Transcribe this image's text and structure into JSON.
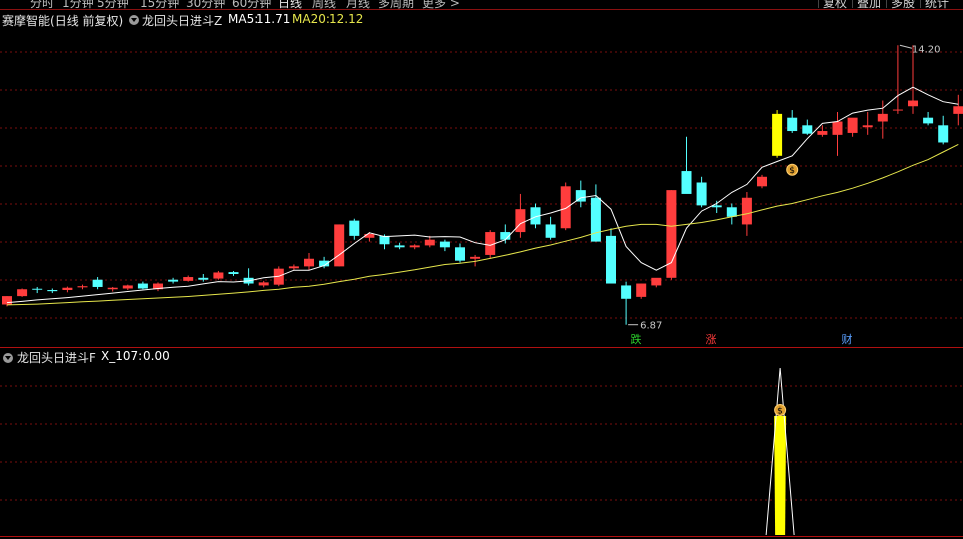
{
  "toolbar": {
    "periods": [
      "分时",
      "1分钟",
      "5分钟",
      "15分钟",
      "30分钟",
      "60分钟",
      "日线",
      "周线",
      "月线",
      "多周期",
      "更多 >"
    ],
    "active_period": "日线",
    "buttons": [
      "复权",
      "叠加",
      "多股",
      "统计"
    ]
  },
  "main_panel": {
    "stock_name": "赛摩智能",
    "view_mode": "(日线 前复权)",
    "indicator_name": "龙回头日进斗Z",
    "ma5_label": "MA5:",
    "ma5_value": "11.71",
    "ma20_label": "MA20:",
    "ma20_value": "12.12",
    "max_label": "14.20",
    "min_label": "6.87",
    "event_tags": [
      {
        "text": "跌",
        "color": "#2bd02b"
      },
      {
        "text": "涨",
        "color": "#ff3c3c"
      },
      {
        "text": "财",
        "color": "#5aa0ff"
      }
    ]
  },
  "sub_panel": {
    "indicator_name": "龙回头日进斗F",
    "var_label": "X_107:",
    "var_value": "0.00"
  },
  "colors": {
    "up": "#ff3d3d",
    "down": "#54ffff",
    "ma5": "#ffffff",
    "ma20": "#e6e64c",
    "grid": "#7a0e0e",
    "signal": "#ffff00",
    "special": "#ffff00"
  },
  "chart_data": [
    {
      "type": "candlestick",
      "title": "赛摩智能 (日线 前复权)",
      "ylim": [
        6.6,
        14.6
      ],
      "series": [
        {
          "name": "MA5",
          "values": [
            7.45,
            7.48,
            7.52,
            7.55,
            7.58,
            7.62,
            7.66,
            7.7,
            7.74,
            7.78,
            7.82,
            7.85,
            7.88,
            7.94,
            8.0,
            7.99,
            8.02,
            8.1,
            8.14,
            8.3,
            8.3,
            8.42,
            8.7,
            9.0,
            9.28,
            9.18,
            9.2,
            9.22,
            9.17,
            9.18,
            9.17,
            9.02,
            8.95,
            9.1,
            9.52,
            9.7,
            9.8,
            9.92,
            10.2,
            10.26,
            9.9,
            8.92,
            8.5,
            8.3,
            8.5,
            9.4,
            9.85,
            10.05,
            10.34,
            10.55,
            11.0,
            11.15,
            11.3,
            11.75,
            12.15,
            12.2,
            12.42,
            12.5,
            12.55,
            12.88,
            13.1,
            12.9,
            12.72,
            12.65
          ]
        },
        {
          "name": "MA20",
          "values": [
            7.39,
            7.4,
            7.41,
            7.43,
            7.45,
            7.47,
            7.49,
            7.51,
            7.53,
            7.55,
            7.57,
            7.59,
            7.61,
            7.64,
            7.67,
            7.7,
            7.73,
            7.77,
            7.8,
            7.85,
            7.88,
            7.93,
            8.0,
            8.06,
            8.14,
            8.19,
            8.25,
            8.31,
            8.38,
            8.45,
            8.48,
            8.53,
            8.61,
            8.69,
            8.78,
            8.88,
            8.96,
            9.06,
            9.16,
            9.28,
            9.37,
            9.45,
            9.5,
            9.5,
            9.45,
            9.5,
            9.55,
            9.62,
            9.7,
            9.78,
            9.88,
            9.98,
            10.05,
            10.15,
            10.25,
            10.34,
            10.45,
            10.58,
            10.72,
            10.88,
            11.05,
            11.2,
            11.4,
            11.6
          ]
        }
      ],
      "ohlc": [
        [
          7.4,
          7.62,
          7.35,
          7.62
        ],
        [
          7.62,
          7.82,
          7.6,
          7.8
        ],
        [
          7.8,
          7.86,
          7.7,
          7.78
        ],
        [
          7.78,
          7.82,
          7.7,
          7.75
        ],
        [
          7.78,
          7.87,
          7.72,
          7.84
        ],
        [
          7.85,
          7.92,
          7.8,
          7.88
        ],
        [
          8.05,
          8.12,
          7.8,
          7.86
        ],
        [
          7.8,
          7.86,
          7.74,
          7.84
        ],
        [
          7.82,
          7.92,
          7.78,
          7.9
        ],
        [
          7.95,
          8.0,
          7.8,
          7.82
        ],
        [
          7.8,
          7.98,
          7.75,
          7.95
        ],
        [
          8.05,
          8.1,
          7.95,
          8.0
        ],
        [
          8.02,
          8.16,
          8.0,
          8.12
        ],
        [
          8.1,
          8.2,
          8.0,
          8.05
        ],
        [
          8.08,
          8.28,
          8.05,
          8.24
        ],
        [
          8.25,
          8.28,
          8.15,
          8.2
        ],
        [
          8.1,
          8.35,
          7.9,
          7.95
        ],
        [
          7.9,
          8.02,
          7.85,
          7.98
        ],
        [
          7.92,
          8.4,
          7.88,
          8.34
        ],
        [
          8.35,
          8.45,
          8.3,
          8.4
        ],
        [
          8.4,
          8.75,
          8.3,
          8.6
        ],
        [
          8.55,
          8.65,
          8.35,
          8.4
        ],
        [
          8.4,
          9.5,
          8.4,
          9.5
        ],
        [
          9.6,
          9.65,
          9.1,
          9.2
        ],
        [
          9.15,
          9.3,
          9.05,
          9.25
        ],
        [
          9.2,
          9.24,
          8.85,
          8.98
        ],
        [
          8.95,
          9.02,
          8.85,
          8.9
        ],
        [
          8.9,
          8.98,
          8.85,
          8.95
        ],
        [
          8.95,
          9.2,
          8.9,
          9.1
        ],
        [
          9.05,
          9.1,
          8.8,
          8.9
        ],
        [
          8.9,
          9.0,
          8.5,
          8.55
        ],
        [
          8.6,
          8.7,
          8.4,
          8.65
        ],
        [
          8.7,
          9.35,
          8.6,
          9.3
        ],
        [
          9.3,
          9.5,
          9.0,
          9.1
        ],
        [
          9.3,
          10.3,
          9.15,
          9.9
        ],
        [
          9.95,
          10.05,
          9.4,
          9.5
        ],
        [
          9.5,
          9.7,
          9.1,
          9.15
        ],
        [
          9.4,
          10.6,
          9.35,
          10.5
        ],
        [
          10.4,
          10.65,
          9.95,
          10.1
        ],
        [
          10.2,
          10.55,
          9.05,
          9.05
        ],
        [
          9.2,
          9.4,
          8.05,
          7.95
        ],
        [
          7.9,
          8.0,
          6.87,
          7.55
        ],
        [
          7.6,
          7.95,
          7.55,
          7.95
        ],
        [
          7.9,
          8.05,
          7.85,
          8.1
        ],
        [
          8.1,
          10.4,
          8.05,
          10.4
        ],
        [
          10.9,
          11.8,
          10.4,
          10.3
        ],
        [
          10.6,
          10.75,
          9.95,
          10.0
        ],
        [
          10.0,
          10.12,
          9.8,
          9.95
        ],
        [
          9.95,
          10.05,
          9.5,
          9.7
        ],
        [
          9.5,
          10.35,
          9.2,
          10.2
        ],
        [
          10.5,
          10.8,
          10.45,
          10.75
        ],
        [
          11.3,
          12.5,
          11.25,
          12.4
        ],
        [
          12.3,
          12.5,
          11.9,
          11.95
        ],
        [
          12.1,
          12.25,
          11.85,
          11.88
        ],
        [
          11.85,
          12.1,
          11.8,
          11.95
        ],
        [
          11.85,
          12.45,
          11.3,
          12.2
        ],
        [
          11.9,
          12.25,
          11.8,
          12.3
        ],
        [
          12.05,
          12.45,
          11.85,
          12.1
        ],
        [
          12.2,
          12.75,
          11.75,
          12.4
        ],
        [
          12.5,
          14.2,
          12.4,
          12.5
        ],
        [
          12.6,
          14.2,
          12.4,
          12.75
        ],
        [
          12.3,
          12.45,
          12.1,
          12.15
        ],
        [
          12.1,
          12.35,
          11.6,
          11.65
        ],
        [
          12.4,
          12.9,
          12.1,
          12.6
        ]
      ],
      "special_candle_index": 51,
      "max_price": 14.2,
      "min_price": 6.87
    },
    {
      "type": "line",
      "title": "龙回头日进斗F",
      "ylim": [
        0,
        1.0
      ],
      "series": [
        {
          "name": "X_107",
          "values": [
            0,
            0,
            0,
            0,
            0,
            0,
            0,
            0,
            0,
            0,
            0,
            0,
            0,
            0,
            0,
            0,
            0,
            0,
            0,
            0,
            0,
            0,
            0,
            0,
            0,
            0,
            0,
            0,
            0,
            0,
            0,
            0,
            0,
            0,
            0,
            0,
            0,
            0,
            0,
            0,
            0,
            0,
            0,
            0,
            0,
            0,
            0,
            0,
            0,
            0,
            0,
            0,
            1,
            0,
            0,
            0,
            0,
            0,
            0,
            0,
            0,
            0,
            0,
            0
          ]
        }
      ],
      "signal_index": 52
    }
  ]
}
